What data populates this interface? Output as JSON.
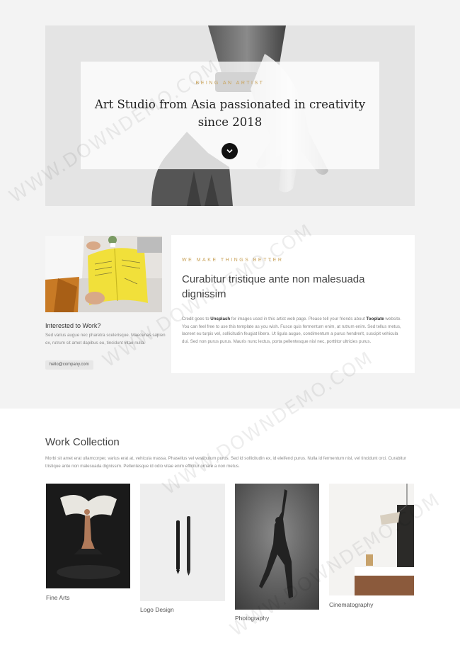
{
  "hero": {
    "eyebrow": "Being an artist",
    "title": "Art Studio from Asia passionated in creativity since 2018",
    "scroll_button_icon": "chevron-down-icon"
  },
  "about": {
    "side_title": "Interested to Work?",
    "side_text": "Sed varius augue nec pharetra scelerisque. Maecenas sapien ex, rutrum sit amet dapibus eu, tincidunt vitae nulla.",
    "email": "hello@company.com",
    "eyebrow": "We make things better",
    "title": "Curabitur tristique ante non malesuada dignissim",
    "text_prefix": "Credit goes to ",
    "text_bold_1": "Unsplash",
    "text_mid": " for images used in this artist web page. Please tell your friends about ",
    "text_bold_2": "Tooplate",
    "text_suffix": " website. You can feel free to use this template as you wish. Fusce quis fermentum enim, at rutrum enim. Sed tellus metus, laoreet eu turpis vel, sollicitudin feugiat libero. Ut ligula augue, condimentum a purus hendrerit, suscipit vehicula dui. Sed non purus purus. Mauris nunc lectus, porta pellentesque nisl nec, porttitor ultricies purus."
  },
  "work": {
    "title": "Work Collection",
    "text": "Morbi sit amet erat ullamcorper, varius erat at, vehicula massa. Phasellus vel vestibulum purus. Sed id sollicitudin ex, id eleifend purus. Nulla id fermentum nisl, vel tincidunt orci. Curabitur tristique ante non malesuada dignissim. Pellentesque id odio vitae enim efficitur ornare a non metus.",
    "items": [
      {
        "label": "Fine Arts"
      },
      {
        "label": "Logo Design"
      },
      {
        "label": "Photography"
      },
      {
        "label": "Cinematography"
      }
    ]
  },
  "watermark": "WWW.DOWNDEMO.COM",
  "colors": {
    "accent": "#c9a35a",
    "background": "#f3f3f3",
    "card": "#ffffff",
    "dark": "#111111"
  }
}
